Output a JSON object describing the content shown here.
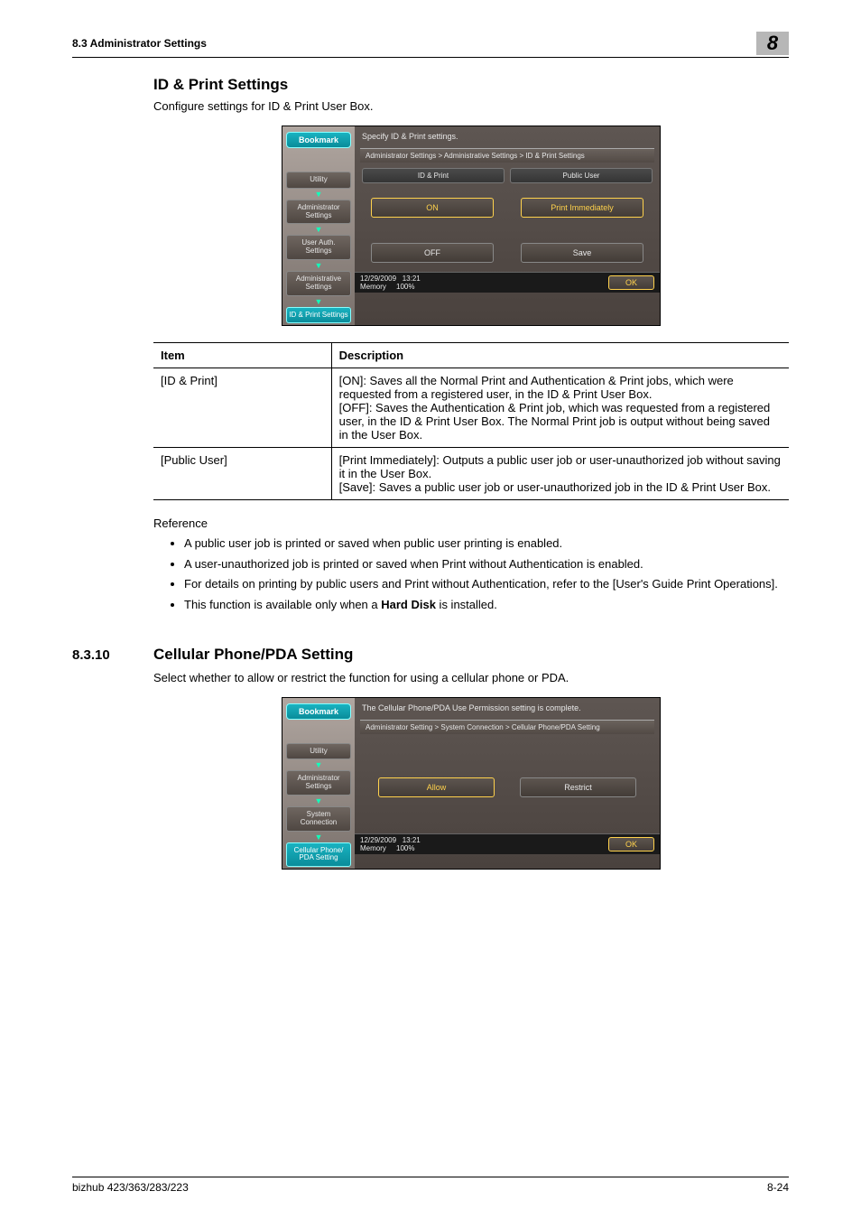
{
  "header": {
    "left": "8.3      Administrator Settings",
    "right": "8"
  },
  "section1": {
    "title": "ID & Print Settings",
    "intro": "Configure settings for ID & Print User Box."
  },
  "shot1": {
    "bookmark": "Bookmark",
    "nav": {
      "utility": "Utility",
      "admin": "Administrator Settings",
      "userauth": "User Auth. Settings",
      "administrative": "Administrative Settings",
      "idprint": "ID & Print Settings"
    },
    "instr": "Specify ID & Print settings.",
    "breadcrumb": "Administrator Settings > Administrative Settings > ID & Print Settings",
    "tabs": {
      "idprint": "ID & Print",
      "publicuser": "Public User"
    },
    "opts": {
      "on": "ON",
      "printimm": "Print Immediately",
      "off": "OFF",
      "save": "Save"
    },
    "footer": {
      "date": "12/29/2009",
      "time": "13:21",
      "memlabel": "Memory",
      "mem": "100%",
      "ok": "OK"
    }
  },
  "table": {
    "h1": "Item",
    "h2": "Description",
    "r1c1": "[ID & Print]",
    "r1c2": "[ON]: Saves all the Normal Print and Authentication & Print jobs, which were requested from a registered user, in the ID & Print User Box.\n[OFF]: Saves the Authentication & Print job, which was requested from a registered user, in the ID & Print User Box. The Normal Print job is output without being saved in the User Box.",
    "r2c1": "[Public User]",
    "r2c2": "[Print Immediately]: Outputs a public user job or user-unauthorized job without saving it in the User Box.\n[Save]: Saves a public user job or user-unauthorized job in the ID & Print User Box."
  },
  "reference": {
    "label": "Reference",
    "items": [
      "A public user job is printed or saved when public user printing is enabled.",
      "A user-unauthorized job is printed or saved when Print without Authentication is enabled.",
      "For details on printing by public users and Print without Authentication, refer to the [User's Guide Print Operations].",
      "This function is available only when a Hard Disk is installed."
    ],
    "bold_in_last": "Hard Disk"
  },
  "section2": {
    "num": "8.3.10",
    "title": "Cellular Phone/PDA Setting",
    "intro": "Select whether to allow or restrict the function for using a cellular phone or PDA."
  },
  "shot2": {
    "bookmark": "Bookmark",
    "nav": {
      "utility": "Utility",
      "admin": "Administrator Settings",
      "sysconn": "System Connection",
      "cellpda": "Cellular Phone/ PDA Setting"
    },
    "instr": "The Cellular Phone/PDA Use Permission setting is complete.",
    "breadcrumb": "Administrator Setting > System Connection > Cellular Phone/PDA Setting",
    "opts": {
      "allow": "Allow",
      "restrict": "Restrict"
    },
    "footer": {
      "date": "12/29/2009",
      "time": "13:21",
      "memlabel": "Memory",
      "mem": "100%",
      "ok": "OK"
    }
  },
  "footer": {
    "left": "bizhub 423/363/283/223",
    "right": "8-24"
  }
}
